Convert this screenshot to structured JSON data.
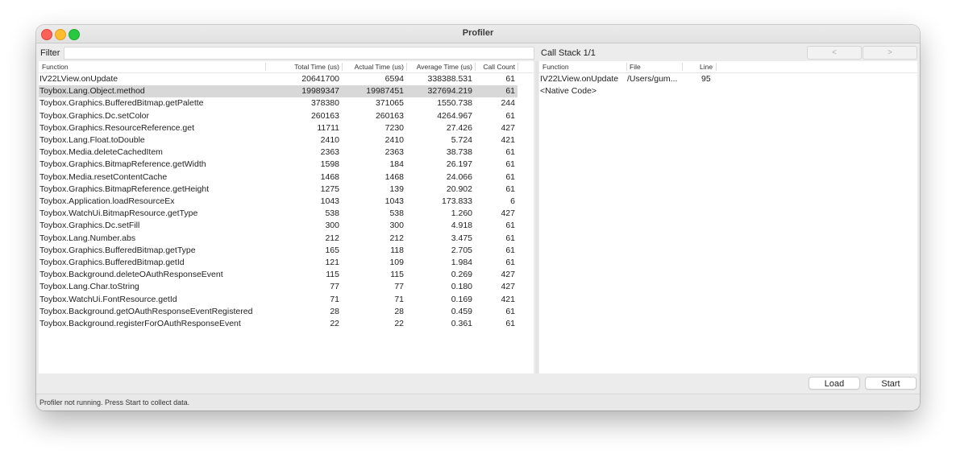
{
  "window": {
    "title": "Profiler"
  },
  "filter": {
    "label": "Filter",
    "value": ""
  },
  "functions_table": {
    "columns": [
      "Function",
      "Total Time (us)",
      "Actual Time (us)",
      "Average Time (us)",
      "Call Count"
    ],
    "rows": [
      [
        "IV22LView.onUpdate",
        "20641700",
        "6594",
        "338388.531",
        "61"
      ],
      [
        "Toybox.Lang.Object.method",
        "19989347",
        "19987451",
        "327694.219",
        "61"
      ],
      [
        "Toybox.Graphics.BufferedBitmap.getPalette",
        "378380",
        "371065",
        "1550.738",
        "244"
      ],
      [
        "Toybox.Graphics.Dc.setColor",
        "260163",
        "260163",
        "4264.967",
        "61"
      ],
      [
        "Toybox.Graphics.ResourceReference.get",
        "11711",
        "7230",
        "27.426",
        "427"
      ],
      [
        "Toybox.Lang.Float.toDouble",
        "2410",
        "2410",
        "5.724",
        "421"
      ],
      [
        "Toybox.Media.deleteCachedItem",
        "2363",
        "2363",
        "38.738",
        "61"
      ],
      [
        "Toybox.Graphics.BitmapReference.getWidth",
        "1598",
        "184",
        "26.197",
        "61"
      ],
      [
        "Toybox.Media.resetContentCache",
        "1468",
        "1468",
        "24.066",
        "61"
      ],
      [
        "Toybox.Graphics.BitmapReference.getHeight",
        "1275",
        "139",
        "20.902",
        "61"
      ],
      [
        "Toybox.Application.loadResourceEx",
        "1043",
        "1043",
        "173.833",
        "6"
      ],
      [
        "Toybox.WatchUi.BitmapResource.getType",
        "538",
        "538",
        "1.260",
        "427"
      ],
      [
        "Toybox.Graphics.Dc.setFill",
        "300",
        "300",
        "4.918",
        "61"
      ],
      [
        "Toybox.Lang.Number.abs",
        "212",
        "212",
        "3.475",
        "61"
      ],
      [
        "Toybox.Graphics.BufferedBitmap.getType",
        "165",
        "118",
        "2.705",
        "61"
      ],
      [
        "Toybox.Graphics.BufferedBitmap.getId",
        "121",
        "109",
        "1.984",
        "61"
      ],
      [
        "Toybox.Background.deleteOAuthResponseEvent",
        "115",
        "115",
        "0.269",
        "427"
      ],
      [
        "Toybox.Lang.Char.toString",
        "77",
        "77",
        "0.180",
        "427"
      ],
      [
        "Toybox.WatchUi.FontResource.getId",
        "71",
        "71",
        "0.169",
        "421"
      ],
      [
        "Toybox.Background.getOAuthResponseEventRegistered",
        "28",
        "28",
        "0.459",
        "61"
      ],
      [
        "Toybox.Background.registerForOAuthResponseEvent",
        "22",
        "22",
        "0.361",
        "61"
      ]
    ],
    "selected_row": 1
  },
  "call_stack": {
    "label": "Call Stack 1/1",
    "prev_label": "<",
    "next_label": ">",
    "columns": [
      "Function",
      "File",
      "Line"
    ],
    "rows": [
      [
        "IV22LView.onUpdate",
        "/Users/gum...",
        "95"
      ],
      [
        "<Native Code>",
        "",
        ""
      ]
    ]
  },
  "buttons": {
    "load": "Load",
    "start": "Start"
  },
  "status": {
    "text": "Profiler not running. Press Start to collect data."
  }
}
